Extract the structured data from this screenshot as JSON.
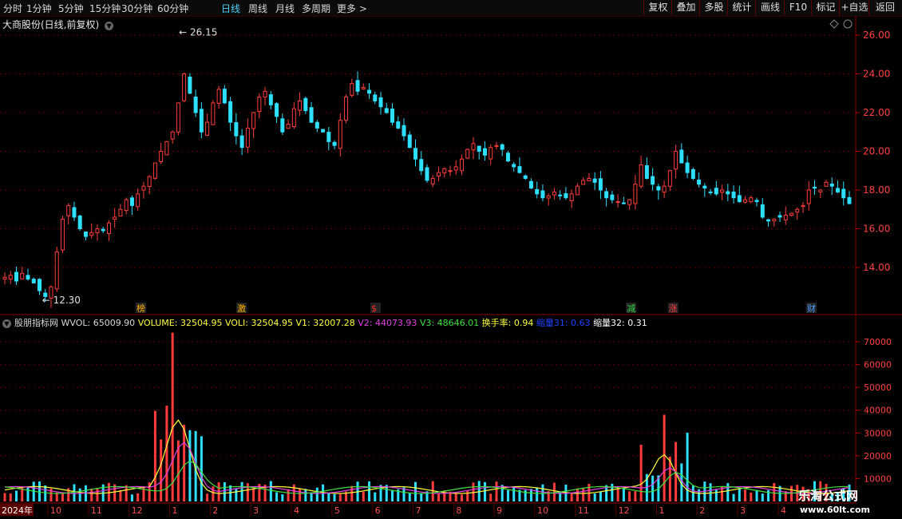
{
  "toolbar": {
    "periods": [
      "分时",
      "1分钟",
      "5分钟",
      "15分钟",
      "30分钟",
      "60分钟",
      "日线",
      "周线",
      "月线",
      "多周期",
      "更多 >"
    ],
    "active_period": "日线",
    "right_buttons": [
      "复权",
      "叠加",
      "多股",
      "统计",
      "画线",
      "F10",
      "标记",
      "+自选",
      "返回"
    ]
  },
  "chart": {
    "title": "大商股份(日线,前复权)",
    "max_label": "26.15",
    "min_label": "12.30",
    "y_ticks": [
      "26.00",
      "24.00",
      "22.00",
      "20.00",
      "18.00",
      "16.00",
      "14.00"
    ],
    "markers": [
      {
        "text": "榜",
        "color": "#ffb000",
        "xf": 0.16
      },
      {
        "text": "激",
        "color": "#ffb000",
        "xf": 0.28
      },
      {
        "text": "$",
        "color": "#ff3030",
        "xf": 0.44
      },
      {
        "text": "减",
        "color": "#30d040",
        "xf": 0.745
      },
      {
        "text": "涨",
        "color": "#ff4040",
        "xf": 0.795
      },
      {
        "text": "财",
        "color": "#4aa0ff",
        "xf": 0.96
      }
    ]
  },
  "volume": {
    "indicator_name": "股朋指标网",
    "items": [
      {
        "text": "WVOL: 65009.90",
        "color": "#d8d8d8"
      },
      {
        "text": "VOLUME: 32504.95",
        "color": "#ffff40"
      },
      {
        "text": "VOLI: 32504.95",
        "color": "#ffff40"
      },
      {
        "text": "V1: 32007.28",
        "color": "#ffff40"
      },
      {
        "text": "V2: 44073.93",
        "color": "#e040e0"
      },
      {
        "text": "V3: 48646.01",
        "color": "#40e040"
      },
      {
        "text": "换手率: 0.94",
        "color": "#ffff40"
      },
      {
        "text": "缩量31: 0.63",
        "color": "#2040ff"
      },
      {
        "text": "缩量32: 0.31",
        "color": "#ffffff"
      }
    ],
    "y_ticks": [
      "70000",
      "60000",
      "50000",
      "40000",
      "30000",
      "20000",
      "10000"
    ]
  },
  "x_axis": {
    "year_label": "2024年",
    "months": [
      "10",
      "11",
      "12",
      "1",
      "2",
      "3",
      "4",
      "5",
      "6",
      "7",
      "8",
      "9",
      "10",
      "11",
      "12",
      "1",
      "2",
      "3",
      "4"
    ]
  },
  "watermark": {
    "line1": "乐淘公式网",
    "line2": "www.60lt.com"
  },
  "chart_data": {
    "type": "candlestick",
    "title": "大商股份(日线,前复权)",
    "closes": [
      13.5,
      13.6,
      13.3,
      13.7,
      13.4,
      13.2,
      12.8,
      12.5,
      13.0,
      14.8,
      16.5,
      17.2,
      16.6,
      16.0,
      15.6,
      15.8,
      16.0,
      15.9,
      16.3,
      16.6,
      17.0,
      17.5,
      17.2,
      17.8,
      18.2,
      18.7,
      19.4,
      20.0,
      20.5,
      21.0,
      22.5,
      24.0,
      23.0,
      22.0,
      21.0,
      21.5,
      22.5,
      23.2,
      22.5,
      21.5,
      20.8,
      20.2,
      21.2,
      22.0,
      22.8,
      23.1,
      22.4,
      21.8,
      21.0,
      21.4,
      22.2,
      22.6,
      22.1,
      21.5,
      21.2,
      21.0,
      20.5,
      20.3,
      21.6,
      22.8,
      23.5,
      23.1,
      23.3,
      23.0,
      22.6,
      22.3,
      22.0,
      21.5,
      21.2,
      20.8,
      20.2,
      19.6,
      19.0,
      18.5,
      18.6,
      18.9,
      19.1,
      19.0,
      19.2,
      19.6,
      20.1,
      20.4,
      20.0,
      19.8,
      20.2,
      20.3,
      20.1,
      19.5,
      19.2,
      18.9,
      18.6,
      18.1,
      17.8,
      17.6,
      17.7,
      17.9,
      17.7,
      17.6,
      17.8,
      18.2,
      18.5,
      18.6,
      18.4,
      18.0,
      17.6,
      17.5,
      17.4,
      17.3,
      17.5,
      18.3,
      19.3,
      18.6,
      18.3,
      18.0,
      18.2,
      19.0,
      20.0,
      19.4,
      18.9,
      18.6,
      18.3,
      18.1,
      17.9,
      17.8,
      18.0,
      17.8,
      17.6,
      17.4,
      17.5,
      17.6,
      17.4,
      16.6,
      16.4,
      16.5,
      16.6,
      16.7,
      16.8,
      17.0,
      17.2,
      18.0,
      18.1,
      18.0,
      18.4,
      18.2,
      17.9,
      17.6,
      17.3
    ]
  }
}
